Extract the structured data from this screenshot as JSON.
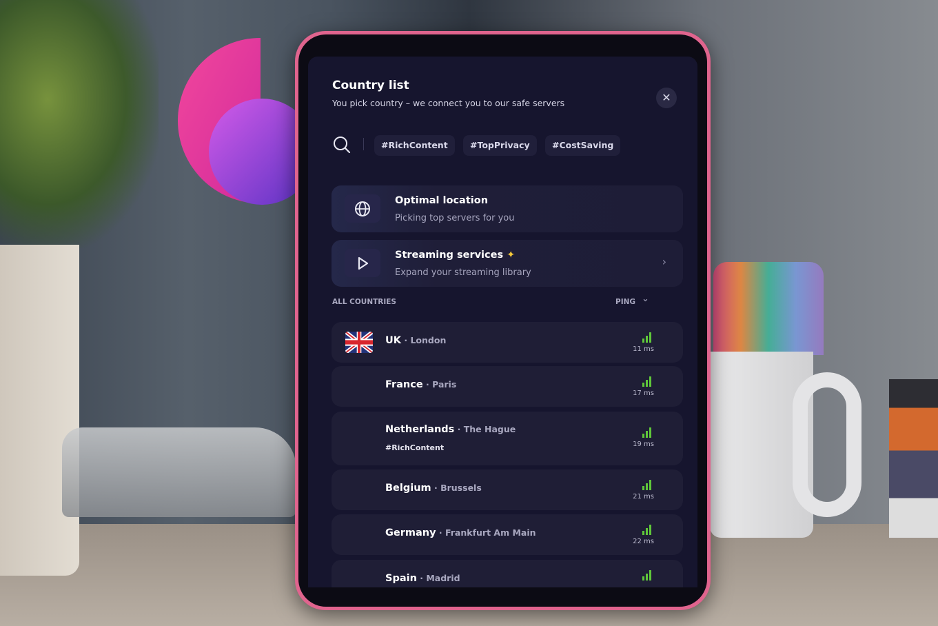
{
  "header": {
    "title": "Country list",
    "subtitle": "You pick country – we connect you to our safe servers",
    "close_icon": "close-icon"
  },
  "search": {
    "icon": "search-icon"
  },
  "tags": [
    "#RichContent",
    "#TopPrivacy",
    "#CostSaving"
  ],
  "cards": [
    {
      "title": "Optimal location",
      "subtitle": "Picking top servers for you",
      "icon": "globe-icon"
    },
    {
      "title": "Streaming services",
      "subtitle": "Expand your streaming library",
      "icon": "play-icon",
      "badge_icon": "sparkle-icon",
      "chevron": "chevron-right-icon"
    }
  ],
  "list": {
    "section_label": "ALL COUNTRIES",
    "sort_label": "PING",
    "countries": [
      {
        "name": "UK",
        "city": "London",
        "ping": "11 ms",
        "tag": ""
      },
      {
        "name": "France",
        "city": "Paris",
        "ping": "17 ms",
        "tag": ""
      },
      {
        "name": "Netherlands",
        "city": "The Hague",
        "ping": "19 ms",
        "tag": "#RichContent"
      },
      {
        "name": "Belgium",
        "city": "Brussels",
        "ping": "21 ms",
        "tag": ""
      },
      {
        "name": "Germany",
        "city": "Frankfurt Am Main",
        "ping": "22 ms",
        "tag": ""
      },
      {
        "name": "Spain",
        "city": "Madrid",
        "ping": "",
        "tag": ""
      }
    ]
  },
  "colors": {
    "panel": "#16152e",
    "row": "#1f1e36",
    "signal": "#5fc73a",
    "frame": "#e0648e",
    "sparkle": "#f3c83a"
  }
}
